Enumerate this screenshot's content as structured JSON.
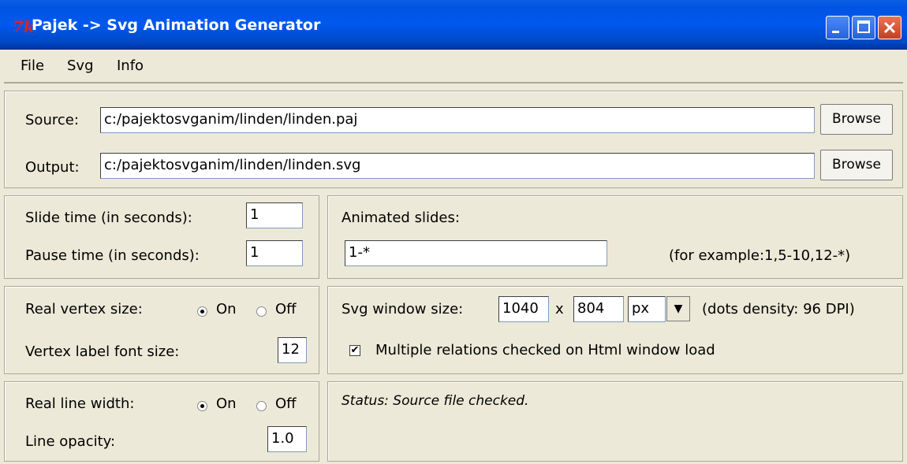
{
  "window": {
    "icon": "tk-icon",
    "icon_text": "7k",
    "title": "Pajek -> Svg Animation Generator",
    "controls": [
      "minimize-icon",
      "maximize-icon",
      "close-icon"
    ]
  },
  "menu": {
    "items": [
      {
        "label": "File"
      },
      {
        "label": "Svg"
      },
      {
        "label": "Info"
      }
    ]
  },
  "files": {
    "source_label": "Source:",
    "source_value": "c:/pajektosvganim/linden/linden.paj",
    "output_label": "Output:",
    "output_value": "c:/pajektosvganim/linden/linden.svg",
    "browse_label": "Browse"
  },
  "timing": {
    "slide_label": "Slide time (in seconds):",
    "slide_value": "1",
    "pause_label": "Pause time (in seconds):",
    "pause_value": "1"
  },
  "animated": {
    "label": "Animated slides:",
    "value": "1-*",
    "hint": "(for example:1,5-10,12-*)"
  },
  "vertex": {
    "real_size_label": "Real vertex size:",
    "on_label": "On",
    "off_label": "Off",
    "selected": "On",
    "font_size_label": "Vertex label font size:",
    "font_size_value": "12"
  },
  "svgwin": {
    "label": "Svg window size:",
    "width": "1040",
    "x_sep": "x",
    "height": "804",
    "unit": "px",
    "density": "(dots density: 96 DPI)",
    "multi_label": "Multiple relations checked on Html window load",
    "multi_checked": true,
    "check_mark": "✔",
    "drop_arrow": "▼"
  },
  "line": {
    "real_width_label": "Real line width:",
    "on_label": "On",
    "off_label": "Off",
    "selected": "On",
    "opacity_label": "Line opacity:",
    "opacity_value": "1.0"
  },
  "status": {
    "text": "Status: Source file checked."
  }
}
